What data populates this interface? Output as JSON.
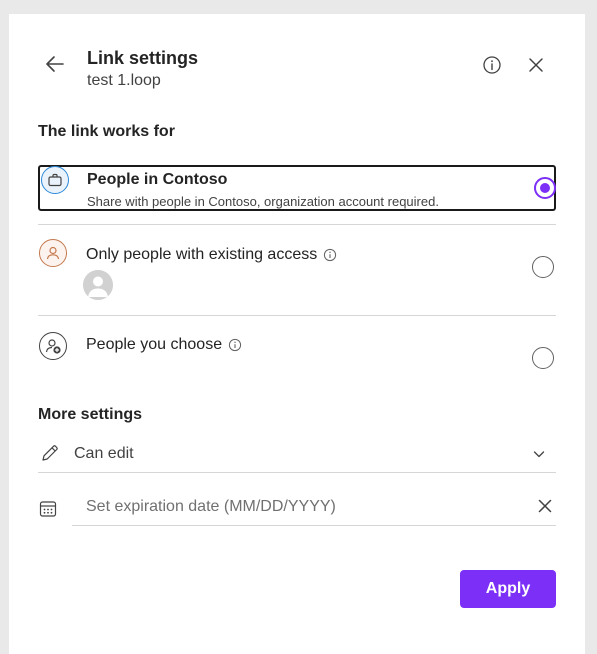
{
  "header": {
    "title": "Link settings",
    "subtitle": "test 1.loop"
  },
  "link_section": {
    "label": "The link works for",
    "options": [
      {
        "title": "People in Contoso",
        "description": "Share with people in Contoso, organization account required.",
        "icon": "briefcase-icon",
        "selected": true
      },
      {
        "title": "Only people with existing access",
        "icon": "person-icon",
        "selected": false
      },
      {
        "title": "People you choose",
        "icon": "person-add-icon",
        "selected": false
      }
    ]
  },
  "more_settings": {
    "label": "More settings",
    "permission_value": "Can edit",
    "expiration_placeholder": "Set expiration date (MM/DD/YYYY)",
    "expiration_value": ""
  },
  "footer": {
    "apply_label": "Apply"
  },
  "colors": {
    "accent": "#7b2ff7",
    "text": "#242424",
    "divider": "#d6d6d6"
  }
}
